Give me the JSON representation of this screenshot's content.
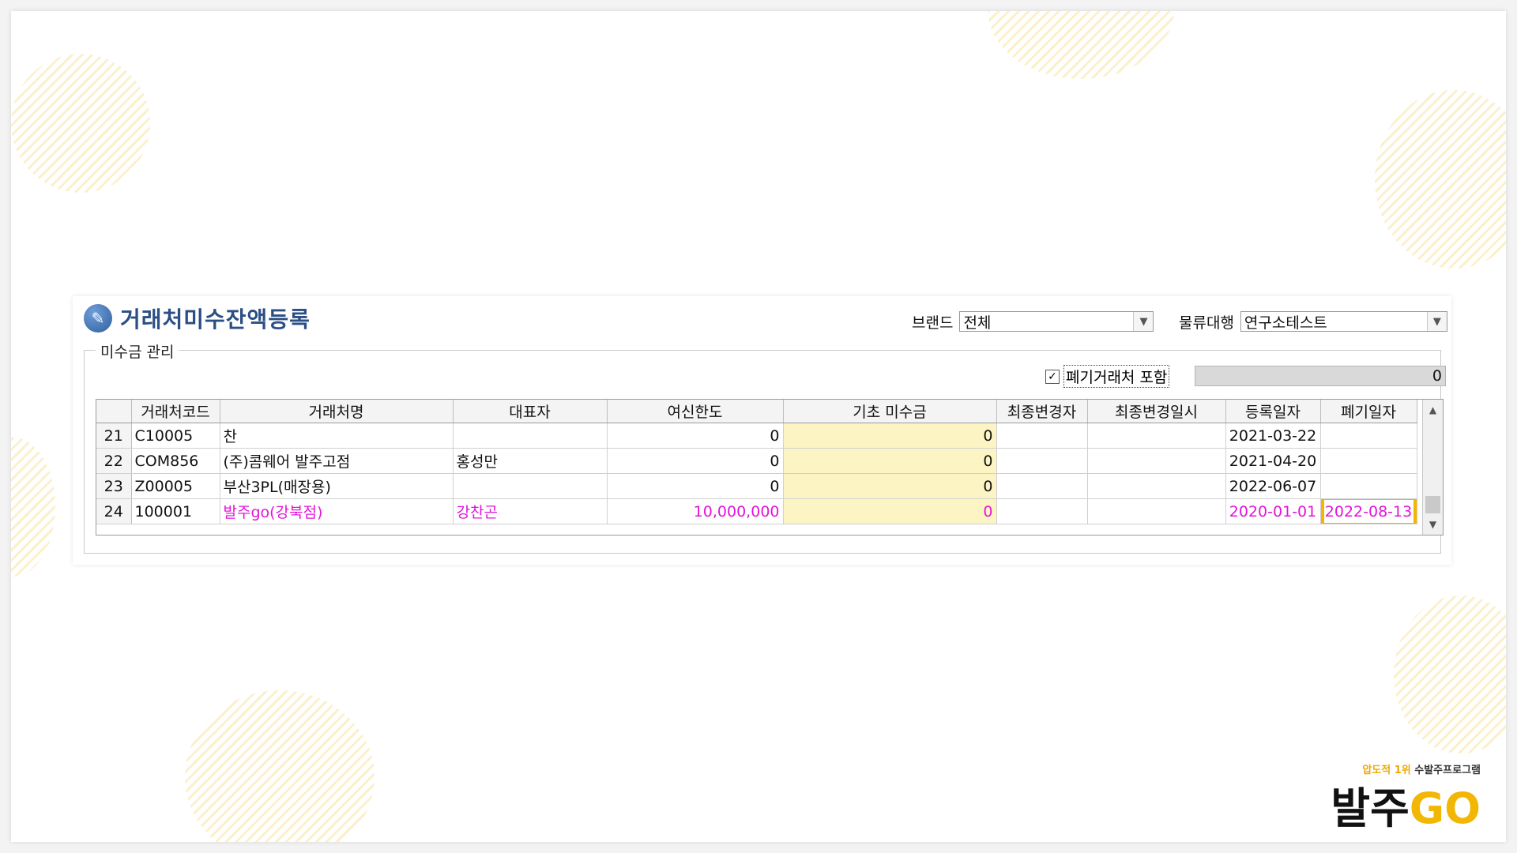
{
  "window": {
    "title": "거래처미수잔액등록"
  },
  "filters": {
    "brand_label": "브랜드",
    "brand_value": "전체",
    "logistics_label": "물류대행",
    "logistics_value": "연구소테스트"
  },
  "group": {
    "legend": "미수금 관리",
    "include_discarded_label": "폐기거래처 포함",
    "include_discarded_checked": true,
    "count_value": "0"
  },
  "table": {
    "columns": [
      "",
      "거래처코드",
      "거래처명",
      "대표자",
      "여신한도",
      "기초 미수금",
      "최종변경자",
      "최종변경일시",
      "등록일자",
      "폐기일자"
    ],
    "rows": [
      {
        "no": "21",
        "code": "C10005",
        "name": "찬",
        "ceo": "",
        "credit": "0",
        "base": "0",
        "changer": "",
        "changed_at": "",
        "reg_date": "2021-03-22",
        "discard_date": ""
      },
      {
        "no": "22",
        "code": "COM856",
        "name": "(주)콤웨어 발주고점",
        "ceo": "홍성만",
        "credit": "0",
        "base": "0",
        "changer": "",
        "changed_at": "",
        "reg_date": "2021-04-20",
        "discard_date": ""
      },
      {
        "no": "23",
        "code": "Z00005",
        "name": "부산3PL(매장용)",
        "ceo": "",
        "credit": "0",
        "base": "0",
        "changer": "",
        "changed_at": "",
        "reg_date": "2022-06-07",
        "discard_date": ""
      },
      {
        "no": "24",
        "code": "100001",
        "name": "발주go(강북점)",
        "ceo": "강찬곤",
        "credit": "10,000,000",
        "base": "0",
        "changer": "",
        "changed_at": "",
        "reg_date": "2020-01-01",
        "discard_date": "2022-08-13"
      }
    ]
  },
  "logo": {
    "tagline_highlight": "압도적 1위",
    "tagline_rest": "수발주프로그램",
    "name_korean": "발주",
    "name_latin": "GO"
  },
  "colors": {
    "discarded_text": "#e214d8",
    "highlight_border": "#f5b400",
    "base_cell_bg": "#fdf4c4",
    "title_text": "#2b4f84"
  }
}
